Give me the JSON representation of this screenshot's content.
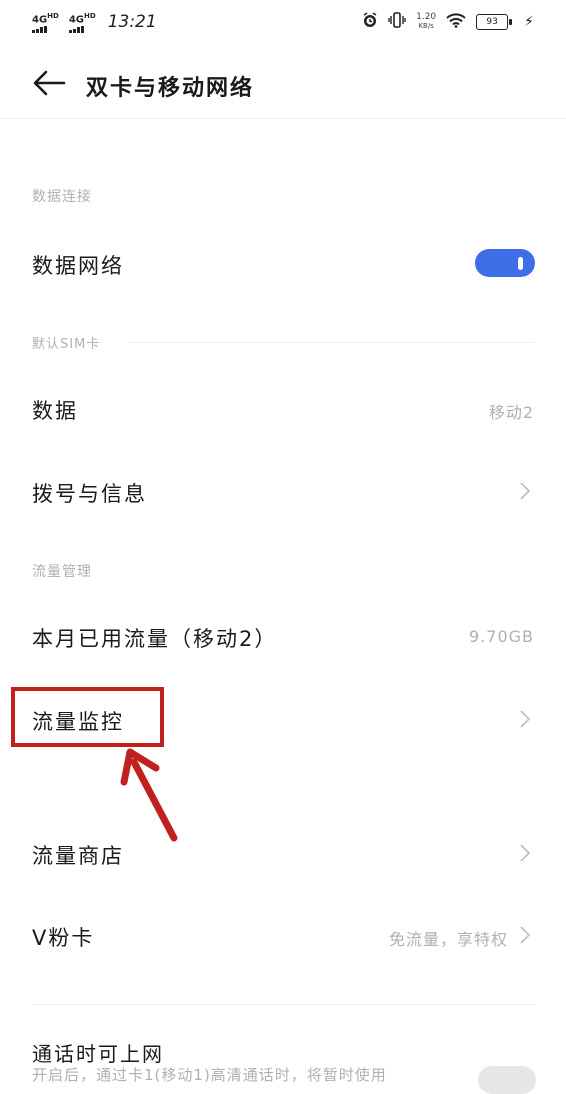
{
  "status_bar": {
    "signal1": "4G",
    "signal1_sup": "HD",
    "signal2": "4G",
    "signal2_sup": "HD",
    "time": "13:21",
    "speed_value": "1.20",
    "speed_unit": "KB/s",
    "battery": "93",
    "icons": [
      "alarm-icon",
      "vibrate-icon",
      "wifi-icon",
      "battery-icon",
      "charging-icon"
    ]
  },
  "header": {
    "title": "双卡与移动网络",
    "back_icon": "back-arrow-icon"
  },
  "sections": {
    "data_connection": {
      "label": "数据连接",
      "mobile_data_label": "数据网络",
      "mobile_data_on": true
    },
    "default_sim": {
      "label": "默认SIM卡",
      "data_label": "数据",
      "data_value": "移动2",
      "call_sms_label": "拨号与信息"
    },
    "traffic": {
      "label": "流量管理",
      "used_label": "本月已用流量（移动2）",
      "used_value": "9.70GB",
      "monitor_label": "流量监控",
      "store_label": "流量商店",
      "vfan_label": "V粉卡",
      "vfan_value": "免流量，享特权"
    },
    "calls": {
      "label": "通话时可上网",
      "description": "开启后，通过卡1(移动1)高清通话时，将暂时使用"
    }
  },
  "colors": {
    "accent": "#3f6fe8",
    "highlight": "#c0211f",
    "secondary_text": "#b0b0b0"
  }
}
